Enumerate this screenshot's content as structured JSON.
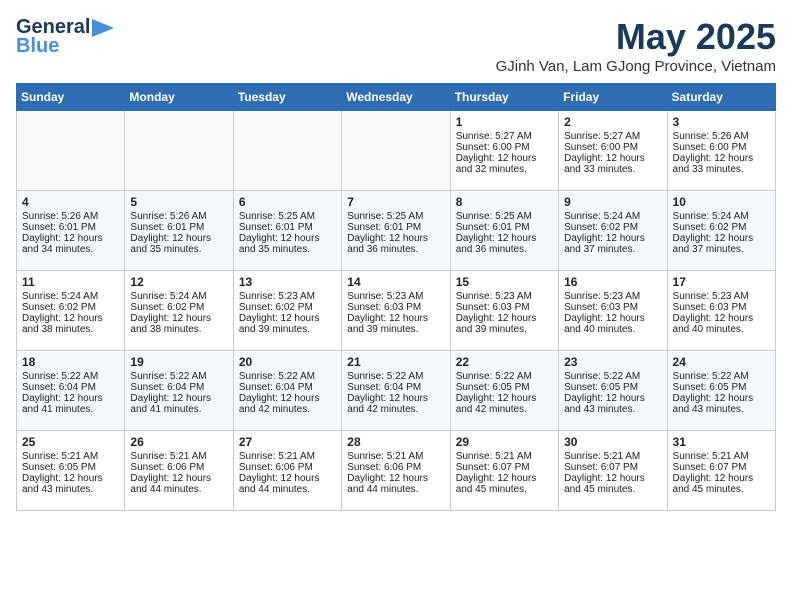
{
  "header": {
    "logo_line1": "General",
    "logo_line2": "Blue",
    "month_title": "May 2025",
    "location": "GJinh Van, Lam GJong Province, Vietnam"
  },
  "days_of_week": [
    "Sunday",
    "Monday",
    "Tuesday",
    "Wednesday",
    "Thursday",
    "Friday",
    "Saturday"
  ],
  "weeks": [
    [
      {
        "day": "",
        "content": ""
      },
      {
        "day": "",
        "content": ""
      },
      {
        "day": "",
        "content": ""
      },
      {
        "day": "",
        "content": ""
      },
      {
        "day": "1",
        "content": "Sunrise: 5:27 AM\nSunset: 6:00 PM\nDaylight: 12 hours\nand 32 minutes."
      },
      {
        "day": "2",
        "content": "Sunrise: 5:27 AM\nSunset: 6:00 PM\nDaylight: 12 hours\nand 33 minutes."
      },
      {
        "day": "3",
        "content": "Sunrise: 5:26 AM\nSunset: 6:00 PM\nDaylight: 12 hours\nand 33 minutes."
      }
    ],
    [
      {
        "day": "4",
        "content": "Sunrise: 5:26 AM\nSunset: 6:01 PM\nDaylight: 12 hours\nand 34 minutes."
      },
      {
        "day": "5",
        "content": "Sunrise: 5:26 AM\nSunset: 6:01 PM\nDaylight: 12 hours\nand 35 minutes."
      },
      {
        "day": "6",
        "content": "Sunrise: 5:25 AM\nSunset: 6:01 PM\nDaylight: 12 hours\nand 35 minutes."
      },
      {
        "day": "7",
        "content": "Sunrise: 5:25 AM\nSunset: 6:01 PM\nDaylight: 12 hours\nand 36 minutes."
      },
      {
        "day": "8",
        "content": "Sunrise: 5:25 AM\nSunset: 6:01 PM\nDaylight: 12 hours\nand 36 minutes."
      },
      {
        "day": "9",
        "content": "Sunrise: 5:24 AM\nSunset: 6:02 PM\nDaylight: 12 hours\nand 37 minutes."
      },
      {
        "day": "10",
        "content": "Sunrise: 5:24 AM\nSunset: 6:02 PM\nDaylight: 12 hours\nand 37 minutes."
      }
    ],
    [
      {
        "day": "11",
        "content": "Sunrise: 5:24 AM\nSunset: 6:02 PM\nDaylight: 12 hours\nand 38 minutes."
      },
      {
        "day": "12",
        "content": "Sunrise: 5:24 AM\nSunset: 6:02 PM\nDaylight: 12 hours\nand 38 minutes."
      },
      {
        "day": "13",
        "content": "Sunrise: 5:23 AM\nSunset: 6:02 PM\nDaylight: 12 hours\nand 39 minutes."
      },
      {
        "day": "14",
        "content": "Sunrise: 5:23 AM\nSunset: 6:03 PM\nDaylight: 12 hours\nand 39 minutes."
      },
      {
        "day": "15",
        "content": "Sunrise: 5:23 AM\nSunset: 6:03 PM\nDaylight: 12 hours\nand 39 minutes."
      },
      {
        "day": "16",
        "content": "Sunrise: 5:23 AM\nSunset: 6:03 PM\nDaylight: 12 hours\nand 40 minutes."
      },
      {
        "day": "17",
        "content": "Sunrise: 5:23 AM\nSunset: 6:03 PM\nDaylight: 12 hours\nand 40 minutes."
      }
    ],
    [
      {
        "day": "18",
        "content": "Sunrise: 5:22 AM\nSunset: 6:04 PM\nDaylight: 12 hours\nand 41 minutes."
      },
      {
        "day": "19",
        "content": "Sunrise: 5:22 AM\nSunset: 6:04 PM\nDaylight: 12 hours\nand 41 minutes."
      },
      {
        "day": "20",
        "content": "Sunrise: 5:22 AM\nSunset: 6:04 PM\nDaylight: 12 hours\nand 42 minutes."
      },
      {
        "day": "21",
        "content": "Sunrise: 5:22 AM\nSunset: 6:04 PM\nDaylight: 12 hours\nand 42 minutes."
      },
      {
        "day": "22",
        "content": "Sunrise: 5:22 AM\nSunset: 6:05 PM\nDaylight: 12 hours\nand 42 minutes."
      },
      {
        "day": "23",
        "content": "Sunrise: 5:22 AM\nSunset: 6:05 PM\nDaylight: 12 hours\nand 43 minutes."
      },
      {
        "day": "24",
        "content": "Sunrise: 5:22 AM\nSunset: 6:05 PM\nDaylight: 12 hours\nand 43 minutes."
      }
    ],
    [
      {
        "day": "25",
        "content": "Sunrise: 5:21 AM\nSunset: 6:05 PM\nDaylight: 12 hours\nand 43 minutes."
      },
      {
        "day": "26",
        "content": "Sunrise: 5:21 AM\nSunset: 6:06 PM\nDaylight: 12 hours\nand 44 minutes."
      },
      {
        "day": "27",
        "content": "Sunrise: 5:21 AM\nSunset: 6:06 PM\nDaylight: 12 hours\nand 44 minutes."
      },
      {
        "day": "28",
        "content": "Sunrise: 5:21 AM\nSunset: 6:06 PM\nDaylight: 12 hours\nand 44 minutes."
      },
      {
        "day": "29",
        "content": "Sunrise: 5:21 AM\nSunset: 6:07 PM\nDaylight: 12 hours\nand 45 minutes."
      },
      {
        "day": "30",
        "content": "Sunrise: 5:21 AM\nSunset: 6:07 PM\nDaylight: 12 hours\nand 45 minutes."
      },
      {
        "day": "31",
        "content": "Sunrise: 5:21 AM\nSunset: 6:07 PM\nDaylight: 12 hours\nand 45 minutes."
      }
    ]
  ]
}
